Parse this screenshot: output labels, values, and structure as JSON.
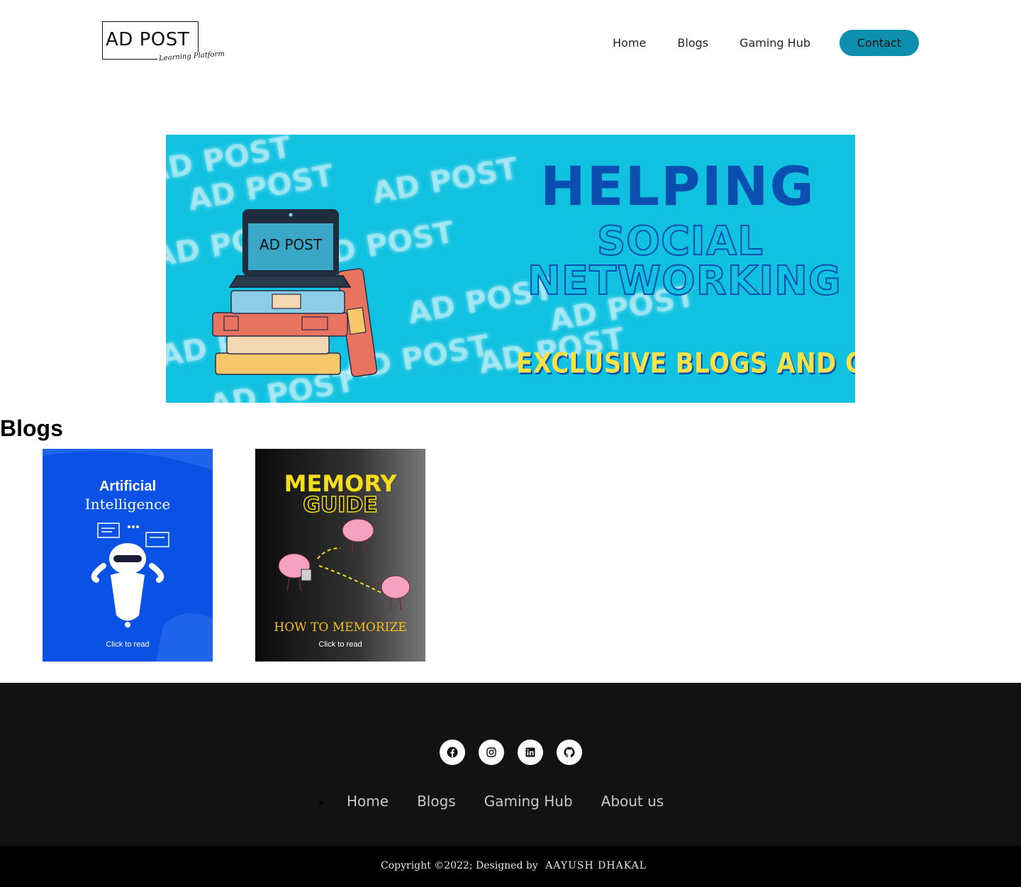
{
  "logo": {
    "word": "AD POST",
    "script": "Learning Platform"
  },
  "nav": {
    "home": "Home",
    "blogs": "Blogs",
    "gaming": "Gaming Hub",
    "contact": "Contact",
    "accent": "#0d8fae"
  },
  "hero": {
    "watermark": "AD POST",
    "laptop_word": "AD POST",
    "headline1": "HELPING",
    "headline2": "SOCIAL",
    "headline3": "NETWORKING",
    "tagline": "EXCLUSIVE BLOGS AND CONTENTS",
    "bg": "#11c2e0",
    "headline_color": "#0a4fb0",
    "tagline_color": "#f5e14a"
  },
  "blogs": {
    "title": "Blogs",
    "cards": [
      {
        "line1": "Artificial",
        "line2": "Intelligence",
        "cta": "Click to read",
        "bg": "#0a52e6"
      },
      {
        "line1": "MEMORY",
        "line2": "GUIDE",
        "line3": "HOW TO MEMORIZE",
        "cta": "Click to read",
        "bg": "#1a1a1a"
      }
    ]
  },
  "footer": {
    "socials": [
      "facebook-icon",
      "instagram-icon",
      "linkedin-icon",
      "github-icon"
    ],
    "links": [
      "Home",
      "Blogs",
      "Gaming Hub",
      "About us"
    ],
    "copyright": "Copyright ©2022; Designed by",
    "author": "AAYUSH DHAKAL"
  }
}
